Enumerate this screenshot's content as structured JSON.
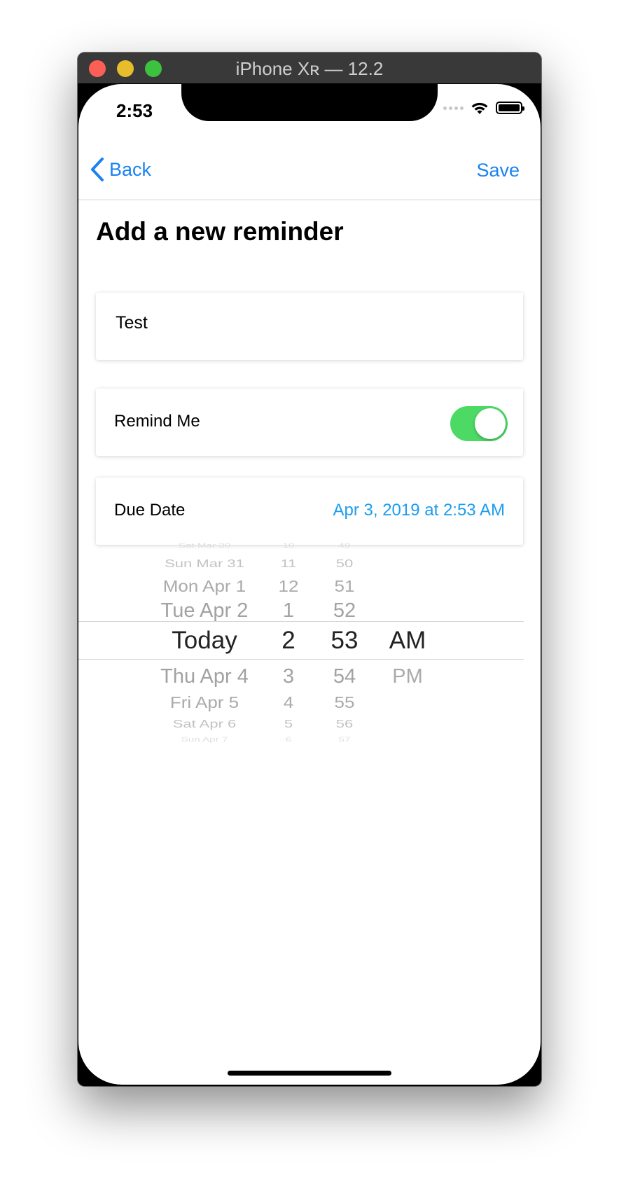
{
  "window": {
    "title": "iPhone Xʀ — 12.2"
  },
  "status_bar": {
    "time": "2:53"
  },
  "nav": {
    "back_label": "Back",
    "save_label": "Save"
  },
  "page": {
    "title": "Add a new reminder"
  },
  "reminder_title": {
    "value": "Test"
  },
  "remind_me": {
    "label": "Remind Me",
    "enabled": true
  },
  "due_date": {
    "label": "Due Date",
    "value": "Apr 3, 2019 at 2:53 AM"
  },
  "date_picker": {
    "dates": [
      "Sat Mar 30",
      "Sun Mar 31",
      "Mon Apr 1",
      "Tue Apr 2",
      "Today",
      "Thu Apr 4",
      "Fri Apr 5",
      "Sat Apr 6",
      "Sun Apr 7"
    ],
    "hours": [
      "10",
      "11",
      "12",
      "1",
      "2",
      "3",
      "4",
      "5",
      "6"
    ],
    "minutes": [
      "49",
      "50",
      "51",
      "52",
      "53",
      "54",
      "55",
      "56",
      "57"
    ],
    "periods": [
      "AM",
      "PM"
    ],
    "selected": {
      "date": "Today",
      "hour": "2",
      "minute": "53",
      "period": "AM"
    }
  },
  "colors": {
    "accent": "#1b82f1",
    "due_value": "#1b9df0",
    "toggle_on": "#4cd964"
  }
}
